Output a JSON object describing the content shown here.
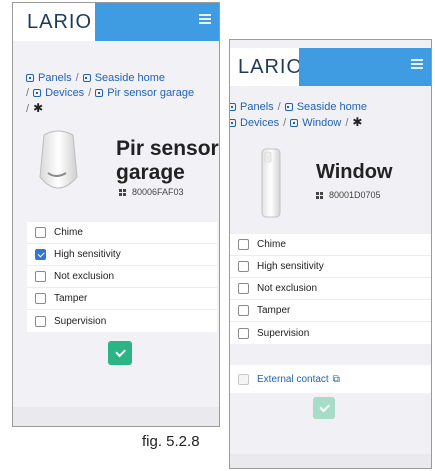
{
  "left": {
    "logo": "LARIO",
    "breadcrumb": {
      "panels": "Panels",
      "home": "Seaside home",
      "devices": "Devices",
      "device": "Pir sensor garage",
      "sep": "/"
    },
    "device_title": "Pir sensor garage",
    "device_id": "80006FAF03",
    "options": [
      {
        "label": "Chime",
        "checked": false
      },
      {
        "label": "High sensitivity",
        "checked": true
      },
      {
        "label": "Not exclusion",
        "checked": false
      },
      {
        "label": "Tamper",
        "checked": false
      },
      {
        "label": "Supervision",
        "checked": false
      }
    ]
  },
  "right": {
    "logo": "LARIO",
    "breadcrumb": {
      "panels": "Panels",
      "home": "Seaside home",
      "devices": "Devices",
      "device": "Window",
      "sep": "/"
    },
    "device_title": "Window",
    "device_id": "80001D0705",
    "options": [
      {
        "label": "Chime",
        "checked": false
      },
      {
        "label": "High sensitivity",
        "checked": false
      },
      {
        "label": "Not exclusion",
        "checked": false
      },
      {
        "label": "Tamper",
        "checked": false
      },
      {
        "label": "Supervision",
        "checked": false
      }
    ],
    "external_contact": "External contact"
  },
  "caption": "fig. 5.2.8",
  "colors": {
    "accent_bar": "#3f9ce3",
    "link": "#1f62b5",
    "save": "#2bb585",
    "save_disabled": "#a7ddc6",
    "checked": "#2f77d4"
  },
  "icons": {
    "menu": "hamburger-icon",
    "breadcrumb": "panel-icon",
    "settings": "gear-icon",
    "device_id": "grid-icon",
    "external": "external-link-icon",
    "save": "check-icon"
  }
}
